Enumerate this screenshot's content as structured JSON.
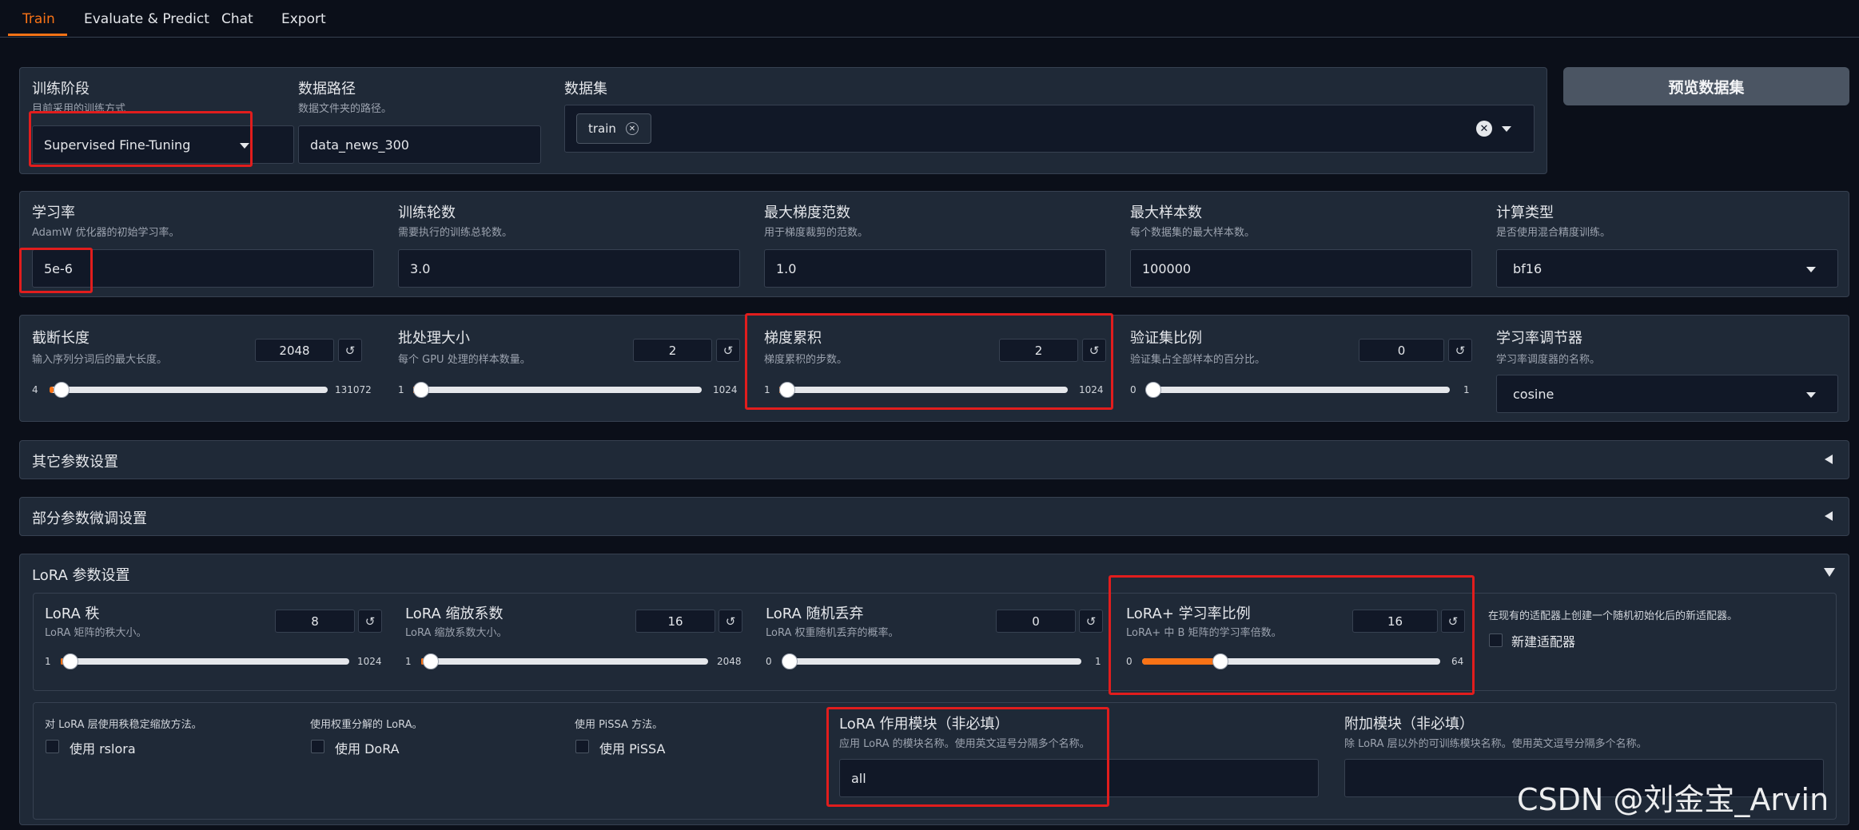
{
  "tabs": [
    "Train",
    "Evaluate & Predict",
    "Chat",
    "Export"
  ],
  "row1": {
    "stage": {
      "label": "训练阶段",
      "info": "目前采用的训练方式",
      "value": "Supervised Fine-Tuning"
    },
    "dataset_dir": {
      "label": "数据路径",
      "info": "数据文件夹的路径。",
      "value": "data_news_300"
    },
    "dataset": {
      "label": "数据集",
      "chip": "train"
    },
    "preview_button": "预览数据集"
  },
  "row2": {
    "learning_rate": {
      "label": "学习率",
      "info": "AdamW 优化器的初始学习率。",
      "value": "5e-6"
    },
    "epochs": {
      "label": "训练轮数",
      "info": "需要执行的训练总轮数。",
      "value": "3.0"
    },
    "max_grad_norm": {
      "label": "最大梯度范数",
      "info": "用于梯度裁剪的范数。",
      "value": "1.0"
    },
    "max_samples": {
      "label": "最大样本数",
      "info": "每个数据集的最大样本数。",
      "value": "100000"
    },
    "compute_type": {
      "label": "计算类型",
      "info": "是否使用混合精度训练。",
      "value": "bf16"
    }
  },
  "row3": {
    "cutoff_len": {
      "label": "截断长度",
      "info": "输入序列分词后的最大长度。",
      "value": "2048",
      "min": "4",
      "max": "131072",
      "fraction": 0.0156
    },
    "batch_size": {
      "label": "批处理大小",
      "info": "每个 GPU 处理的样本数量。",
      "value": "2",
      "min": "1",
      "max": "1024",
      "fraction": 0.001
    },
    "grad_accum": {
      "label": "梯度累积",
      "info": "梯度累积的步数。",
      "value": "2",
      "min": "1",
      "max": "1024",
      "fraction": 0.001
    },
    "val_size": {
      "label": "验证集比例",
      "info": "验证集占全部样本的百分比。",
      "value": "0",
      "min": "0",
      "max": "1",
      "fraction": 0.0
    },
    "lr_scheduler": {
      "label": "学习率调节器",
      "info": "学习率调度器的名称。",
      "value": "cosine"
    }
  },
  "accordions": {
    "extra": "其它参数设置",
    "freeze": "部分参数微调设置",
    "lora": "LoRA 参数设置"
  },
  "lora": {
    "rank": {
      "label": "LoRA 秩",
      "info": "LoRA 矩阵的秩大小。",
      "value": "8",
      "min": "1",
      "max": "1024",
      "fraction": 0.007
    },
    "alpha": {
      "label": "LoRA 缩放系数",
      "info": "LoRA 缩放系数大小。",
      "value": "16",
      "min": "1",
      "max": "2048",
      "fraction": 0.007
    },
    "dropout": {
      "label": "LoRA 随机丢弃",
      "info": "LoRA 权重随机丢弃的概率。",
      "value": "0",
      "min": "0",
      "max": "1",
      "fraction": 0.0
    },
    "plus_ratio": {
      "label": "LoRA+ 学习率比例",
      "info": "LoRA+ 中 B 矩阵的学习率倍数。",
      "value": "16",
      "min": "0",
      "max": "64",
      "fraction": 0.25
    },
    "create_new_info": "在现有的适配器上创建一个随机初始化后的新适配器。",
    "create_new_label": "新建适配器",
    "rslora_info": "对 LoRA 层使用秩稳定缩放方法。",
    "rslora_label": "使用 rslora",
    "dora_info": "使用权重分解的 LoRA。",
    "dora_label": "使用 DoRA",
    "pissa_info": "使用 PiSSA 方法。",
    "pissa_label": "使用 PiSSA",
    "target": {
      "label": "LoRA 作用模块（非必填）",
      "info": "应用 LoRA 的模块名称。使用英文逗号分隔多个名称。",
      "value": "all"
    },
    "additional": {
      "label": "附加模块（非必填）",
      "info": "除 LoRA 层以外的可训练模块名称。使用英文逗号分隔多个名称。",
      "value": ""
    }
  },
  "watermark": "CSDN @刘金宝_Arvin"
}
